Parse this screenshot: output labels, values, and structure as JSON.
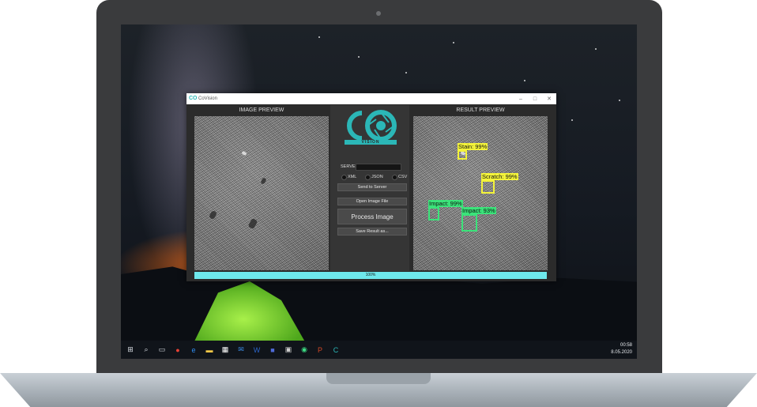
{
  "window": {
    "title": "CoVision"
  },
  "panels": {
    "image_preview": "IMAGE PREVIEW",
    "result_preview": "RESULT PREVIEW"
  },
  "logo": {
    "vision_text": "VISION"
  },
  "controls": {
    "server_label": "SERVER:",
    "server_value": "",
    "formats": [
      "XML",
      "JSON",
      "CSV"
    ],
    "send_button": "Send to Server",
    "open_button": "Open Image File",
    "process_button": "Process Image",
    "save_button": "Save Result as..."
  },
  "detections": [
    {
      "label": "Stain: 99%",
      "color": "#f4f43a"
    },
    {
      "label": "Scratch: 99%",
      "color": "#f4f43a"
    },
    {
      "label": "Impact: 99%",
      "color": "#3be37a"
    },
    {
      "label": "Impact: 93%",
      "color": "#3be37a"
    }
  ],
  "progress": {
    "value": 1.0,
    "text": "100%"
  },
  "taskbar": {
    "time": "00:58",
    "date": "8.05.2020"
  },
  "icons": [
    "windows-start-icon",
    "search-icon",
    "task-view-icon",
    "chrome-icon",
    "edge-icon",
    "file-explorer-icon",
    "store-icon",
    "mail-icon",
    "word-icon",
    "app-icon",
    "terminal-icon",
    "android-studio-icon",
    "powerpoint-icon",
    "covision-icon"
  ],
  "colors": {
    "accent": "#2bb7b7",
    "progress": "#6ee8ec"
  }
}
